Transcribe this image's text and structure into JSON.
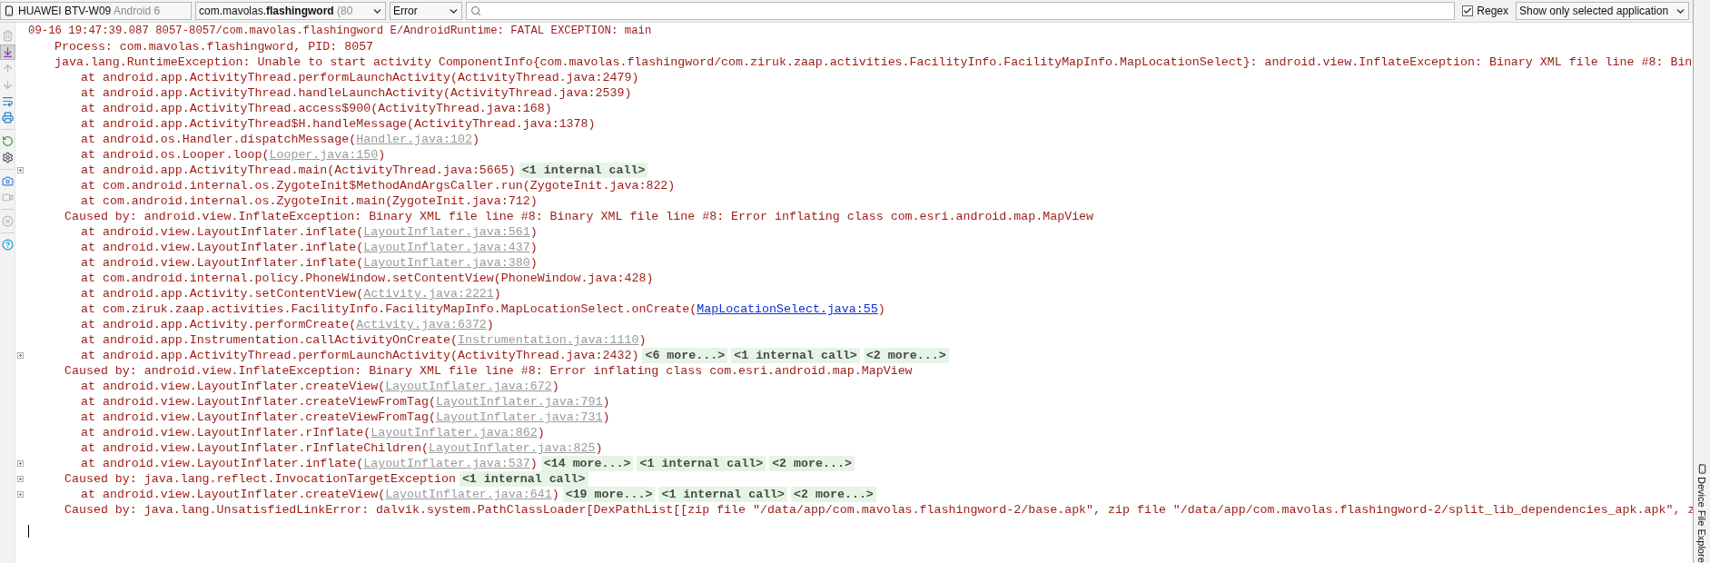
{
  "toolbar": {
    "device": {
      "name": "HUAWEI BTV-W09",
      "detail": "Android 6"
    },
    "process": {
      "name": "com.mavolas.**flashingword**",
      "detail": "(80"
    },
    "level": "Error",
    "regex": {
      "label": "Regex",
      "checked": true
    },
    "filter": "Show only selected application"
  },
  "tools": [
    {
      "kind": "trash",
      "disabled": true,
      "selected": false
    },
    {
      "kind": "scroll-end",
      "disabled": false,
      "selected": true
    },
    {
      "kind": "up",
      "disabled": true,
      "selected": false
    },
    {
      "kind": "down",
      "disabled": true,
      "selected": false
    },
    {
      "kind": "wrap",
      "disabled": false,
      "selected": false
    },
    {
      "kind": "print",
      "disabled": false,
      "selected": false
    },
    {
      "kind": "separator"
    },
    {
      "kind": "restart",
      "disabled": false,
      "selected": false
    },
    {
      "kind": "settings",
      "disabled": false,
      "selected": false
    },
    {
      "kind": "separator"
    },
    {
      "kind": "screenshot",
      "disabled": false,
      "selected": false
    },
    {
      "kind": "record",
      "disabled": true,
      "selected": false
    },
    {
      "kind": "separator"
    },
    {
      "kind": "close",
      "disabled": true,
      "selected": false
    },
    {
      "kind": "separator"
    },
    {
      "kind": "help",
      "disabled": false,
      "selected": false
    }
  ],
  "log": [
    {
      "kind": "header",
      "text": "09-16 19:47:39.087 8057-8057/com.mavolas.flashingword E/AndroidRuntime: FATAL EXCEPTION: main"
    },
    {
      "kind": "detail",
      "text": "Process: com.mavolas.flashingword, PID: 8057"
    },
    {
      "kind": "detail",
      "text": "java.lang.RuntimeException: Unable to start activity ComponentInfo{com.mavolas.flashingword/com.ziruk.zaap.activities.FacilityInfo.FacilityMapInfo.MapLocationSelect}: android.view.InflateException: Binary XML file line #8: Bin"
    },
    {
      "kind": "frame",
      "text": "at android.app.ActivityThread.performLaunchActivity(ActivityThread.java:2479)"
    },
    {
      "kind": "frame",
      "text": "at android.app.ActivityThread.handleLaunchActivity(ActivityThread.java:2539)"
    },
    {
      "kind": "frame",
      "text": "at android.app.ActivityThread.access$900(ActivityThread.java:168)"
    },
    {
      "kind": "frame",
      "text": "at android.app.ActivityThread$H.handleMessage(ActivityThread.java:1378)"
    },
    {
      "kind": "frame",
      "text": "at android.os.Handler.dispatchMessage(",
      "source": {
        "kind": "library",
        "text": "Handler.java:102"
      },
      "tail": ")"
    },
    {
      "kind": "frame",
      "text": "at android.os.Looper.loop(",
      "source": {
        "kind": "library",
        "text": "Looper.java:150"
      },
      "tail": ")"
    },
    {
      "kind": "frame",
      "text": "at android.app.ActivityThread.main(ActivityThread.java:5665)",
      "folds": [
        "<1 internal call>"
      ]
    },
    {
      "kind": "frame",
      "text": "at com.android.internal.os.ZygoteInit$MethodAndArgsCaller.run(ZygoteInit.java:822)"
    },
    {
      "kind": "frame",
      "text": "at com.android.internal.os.ZygoteInit.main(ZygoteInit.java:712)"
    },
    {
      "kind": "cause",
      "text": "Caused by: android.view.InflateException: Binary XML file line #8: Binary XML file line #8: Error inflating class com.esri.android.map.MapView"
    },
    {
      "kind": "frame",
      "text": "at android.view.LayoutInflater.inflate(",
      "source": {
        "kind": "library",
        "text": "LayoutInflater.java:561"
      },
      "tail": ")"
    },
    {
      "kind": "frame",
      "text": "at android.view.LayoutInflater.inflate(",
      "source": {
        "kind": "library",
        "text": "LayoutInflater.java:437"
      },
      "tail": ")"
    },
    {
      "kind": "frame",
      "text": "at android.view.LayoutInflater.inflate(",
      "source": {
        "kind": "library",
        "text": "LayoutInflater.java:380"
      },
      "tail": ")"
    },
    {
      "kind": "frame",
      "text": "at com.android.internal.policy.PhoneWindow.setContentView(PhoneWindow.java:428)"
    },
    {
      "kind": "frame",
      "text": "at android.app.Activity.setContentView(",
      "source": {
        "kind": "library",
        "text": "Activity.java:2221"
      },
      "tail": ")"
    },
    {
      "kind": "frame",
      "text": "at com.ziruk.zaap.activities.FacilityInfo.FacilityMapInfo.MapLocationSelect.onCreate(",
      "source": {
        "kind": "project",
        "text": "MapLocationSelect.java:55"
      },
      "tail": ")"
    },
    {
      "kind": "frame",
      "text": "at android.app.Activity.performCreate(",
      "source": {
        "kind": "library",
        "text": "Activity.java:6372"
      },
      "tail": ")"
    },
    {
      "kind": "frame",
      "text": "at android.app.Instrumentation.callActivityOnCreate(",
      "source": {
        "kind": "library",
        "text": "Instrumentation.java:1110"
      },
      "tail": ")"
    },
    {
      "kind": "frame",
      "text": "at android.app.ActivityThread.performLaunchActivity(ActivityThread.java:2432)",
      "folds": [
        "<6 more...>",
        "<1 internal call>",
        "<2 more...>"
      ]
    },
    {
      "kind": "cause",
      "text": "Caused by: android.view.InflateException: Binary XML file line #8: Error inflating class com.esri.android.map.MapView"
    },
    {
      "kind": "frame",
      "text": "at android.view.LayoutInflater.createView(",
      "source": {
        "kind": "library",
        "text": "LayoutInflater.java:672"
      },
      "tail": ")"
    },
    {
      "kind": "frame",
      "text": "at android.view.LayoutInflater.createViewFromTag(",
      "source": {
        "kind": "library",
        "text": "LayoutInflater.java:791"
      },
      "tail": ")"
    },
    {
      "kind": "frame",
      "text": "at android.view.LayoutInflater.createViewFromTag(",
      "source": {
        "kind": "library",
        "text": "LayoutInflater.java:731"
      },
      "tail": ")"
    },
    {
      "kind": "frame",
      "text": "at android.view.LayoutInflater.rInflate(",
      "source": {
        "kind": "library",
        "text": "LayoutInflater.java:862"
      },
      "tail": ")"
    },
    {
      "kind": "frame",
      "text": "at android.view.LayoutInflater.rInflateChildren(",
      "source": {
        "kind": "library",
        "text": "LayoutInflater.java:825"
      },
      "tail": ")"
    },
    {
      "kind": "frame",
      "text": "at android.view.LayoutInflater.inflate(",
      "source": {
        "kind": "library",
        "text": "LayoutInflater.java:537"
      },
      "tail": ")",
      "folds": [
        "<14 more...>",
        "<1 internal call>",
        "<2 more...>"
      ]
    },
    {
      "kind": "cause",
      "text": "Caused by: java.lang.reflect.InvocationTargetException",
      "folds": [
        "<1 internal call>"
      ]
    },
    {
      "kind": "frame",
      "text": "at android.view.LayoutInflater.createView(",
      "source": {
        "kind": "library",
        "text": "LayoutInflater.java:641"
      },
      "tail": ")",
      "folds": [
        "<19 more...>",
        "<1 internal call>",
        "<2 more...>"
      ]
    },
    {
      "kind": "cause",
      "text": "Caused by: java.lang.UnsatisfiedLinkError: dalvik.system.PathClassLoader[DexPathList[[zip file \"/data/app/com.mavolas.flashingword-2/base.apk\", zip file \"/data/app/com.mavolas.flashingword-2/split_lib_dependencies_apk.apk\", z"
    }
  ],
  "side_panel": {
    "label": "Device File Explore"
  }
}
